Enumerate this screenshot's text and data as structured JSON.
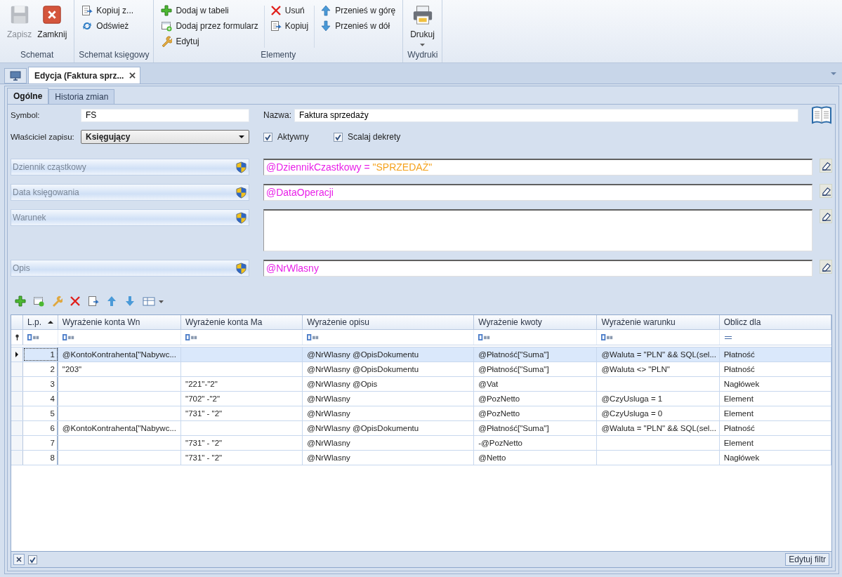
{
  "ribbon": {
    "groups": [
      {
        "label": "Schemat",
        "columns": [
          [
            {
              "label": "Zapisz",
              "kind": "large",
              "disabled": true
            }
          ],
          [
            {
              "label": "Zamknij",
              "kind": "large",
              "disabled": false
            }
          ]
        ]
      },
      {
        "label": "Schemat księgowy",
        "columns": [
          [
            {
              "label": "Kopiuj z...",
              "kind": "small",
              "disabled": false
            },
            {
              "label": "Odśwież",
              "kind": "small",
              "disabled": false
            }
          ]
        ]
      },
      {
        "label": "Elementy",
        "columns": [
          [
            {
              "label": "Dodaj w tabeli",
              "kind": "small",
              "disabled": false
            },
            {
              "label": "Dodaj przez formularz",
              "kind": "small",
              "disabled": false
            },
            {
              "label": "Edytuj",
              "kind": "small",
              "disabled": false
            }
          ],
          [
            {
              "label": "Usuń",
              "kind": "small",
              "disabled": false
            },
            {
              "label": "Kopiuj",
              "kind": "small",
              "disabled": false
            }
          ],
          [
            {
              "label": "Przenieś w górę",
              "kind": "small",
              "disabled": false
            },
            {
              "label": "Przenieś w dół",
              "kind": "small",
              "disabled": false
            }
          ]
        ]
      },
      {
        "label": "Wydruki",
        "columns": [
          [
            {
              "label": "Drukuj",
              "kind": "large",
              "disabled": false,
              "dropdown": true
            }
          ]
        ]
      }
    ]
  },
  "document_tabs": [
    {
      "label": "Edycja (Faktura sprz...",
      "selected": true
    }
  ],
  "tabs": [
    {
      "label": "Ogólne",
      "selected": true
    },
    {
      "label": "Historia zmian",
      "selected": false
    }
  ],
  "form": {
    "symbol": {
      "label": "Symbol:",
      "value": "FS"
    },
    "name": {
      "label": "Nazwa:",
      "value": "Faktura sprzedaży"
    },
    "owner": {
      "label": "Właściciel zapisu:",
      "value": "Księgujący"
    },
    "checkboxes": [
      {
        "label": "Aktywny",
        "checked": true
      },
      {
        "label": "Scalaj dekrety",
        "checked": true
      }
    ],
    "expressions": [
      {
        "label": "Dziennik cząstkowy",
        "multiline": false,
        "segments": [
          {
            "text": "@DziennikCzastkowy =",
            "kind": "variable"
          },
          {
            "text": " \"SPRZEDAŻ\"",
            "kind": "string"
          }
        ]
      },
      {
        "label": "Data księgowania",
        "multiline": false,
        "segments": [
          {
            "text": "@DataOperacji",
            "kind": "variable"
          }
        ]
      },
      {
        "label": "Warunek",
        "multiline": true
      },
      {
        "label": "Opis",
        "multiline": false,
        "segments": [
          {
            "text": "@NrWlasny",
            "kind": "variable"
          }
        ]
      }
    ]
  },
  "grid": {
    "columns": [
      {
        "label": "L.p.",
        "sorted": true,
        "kind": "text"
      },
      {
        "label": "Wyrażenie konta Wn",
        "sorted": false,
        "kind": "text"
      },
      {
        "label": "Wyrażenie konta Ma",
        "sorted": false,
        "kind": "text"
      },
      {
        "label": "Wyrażenie opisu",
        "sorted": false,
        "kind": "text"
      },
      {
        "label": "Wyrażenie kwoty",
        "sorted": false,
        "kind": "text"
      },
      {
        "label": "Wyrażenie warunku",
        "sorted": false,
        "kind": "text"
      },
      {
        "label": "Oblicz dla",
        "sorted": false,
        "kind": "choice"
      }
    ],
    "rows": [
      {
        "selected": true,
        "cells": [
          "1",
          "@KontoKontrahenta[\"Nabywc...",
          null,
          "@NrWlasny @OpisDokumentu",
          "@Płatność[\"Suma\"]",
          "@Waluta = \"PLN\"  && SQL(sel...",
          "Płatność"
        ]
      },
      {
        "selected": false,
        "cells": [
          "2",
          "\"203\"",
          null,
          "@NrWlasny @OpisDokumentu",
          "@Płatność[\"Suma\"]",
          "@Waluta <> \"PLN\"",
          "Płatność"
        ]
      },
      {
        "selected": false,
        "cells": [
          "3",
          null,
          "\"221\"-\"2\"",
          "@NrWlasny @Opis",
          "@Vat",
          null,
          "Nagłówek"
        ]
      },
      {
        "selected": false,
        "cells": [
          "4",
          null,
          "\"702\" -\"2\"",
          "@NrWlasny",
          "@PozNetto",
          "@CzyUsluga = 1",
          "Element"
        ]
      },
      {
        "selected": false,
        "cells": [
          "5",
          null,
          "\"731\" - \"2\"",
          "@NrWlasny",
          "@PozNetto",
          "@CzyUsluga = 0",
          "Element"
        ]
      },
      {
        "selected": false,
        "cells": [
          "6",
          "@KontoKontrahenta[\"Nabywc...",
          null,
          "@NrWlasny @OpisDokumentu",
          "@Płatność[\"Suma\"]",
          "@Waluta = \"PLN\"  && SQL(sel...",
          "Płatność"
        ]
      },
      {
        "selected": false,
        "cells": [
          "7",
          null,
          "\"731\" - \"2\"",
          "@NrWlasny",
          "-@PozNetto",
          null,
          "Element"
        ]
      },
      {
        "selected": false,
        "cells": [
          "8",
          null,
          "\"731\" - \"2\"",
          "@NrWlasny",
          "@Netto",
          null,
          "Nagłówek"
        ]
      }
    ]
  },
  "footer": {
    "filter_enabled": true,
    "button": "Edytuj filtr"
  }
}
